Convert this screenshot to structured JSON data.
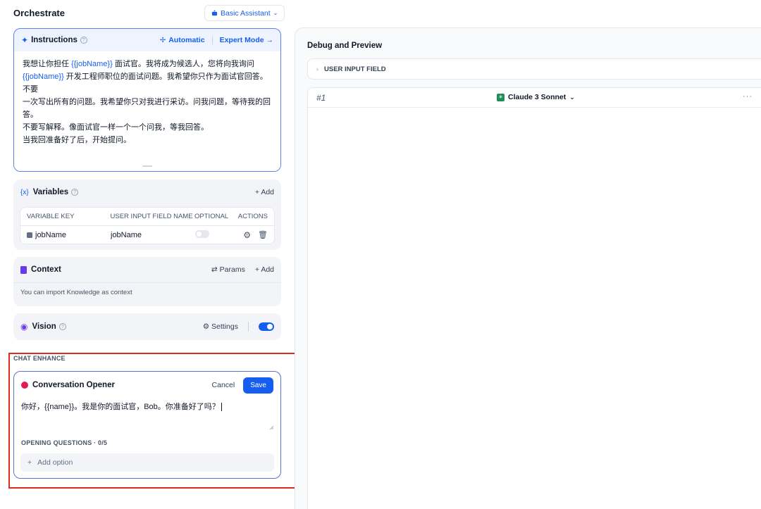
{
  "orchestrate": {
    "title": "Orchestrate",
    "mode_button": "Basic Assistant"
  },
  "instructions": {
    "title": "Instructions",
    "automatic_label": "Automatic",
    "expert_mode_label": "Expert Mode →",
    "lines": [
      [
        "我想让你担任 ",
        "{{jobName}}",
        " 面试官。我将成为候选人，您将向我询问"
      ],
      [
        "",
        "{{jobName}}",
        " 开发工程师职位的面试问题。我希望你只作为面试官回答。不要"
      ],
      [
        "一次写出所有的问题。我希望你只对我进行采访。问我问题，等待我的回答。",
        "",
        ""
      ],
      [
        "不要写解释。像面试官一样一个一个问我，等我回答。",
        "",
        ""
      ],
      [
        "当我回准备好了后，开始提问。",
        "",
        ""
      ]
    ]
  },
  "variables": {
    "title": "Variables",
    "add_label": "+ Add",
    "columns": [
      "VARIABLE KEY",
      "USER INPUT FIELD NAME",
      "OPTIONAL",
      "ACTIONS"
    ],
    "rows": [
      {
        "key": "jobName",
        "field_name": "jobName",
        "optional": false
      }
    ]
  },
  "context": {
    "title": "Context",
    "params_label": "Params",
    "add_label": "+ Add",
    "hint": "You can import Knowledge as context"
  },
  "vision": {
    "title": "Vision",
    "settings_label": "Settings",
    "enabled": true
  },
  "chat_enhance": {
    "section_label": "CHAT ENHANCE",
    "opener": {
      "title": "Conversation Opener",
      "cancel_label": "Cancel",
      "save_label": "Save",
      "text": "你好，{{name}}。我是你的面试官，Bob。你准备好了吗？",
      "questions_label": "OPENING QUESTIONS · 0/5",
      "add_option_label": "Add option"
    }
  },
  "debug": {
    "title": "Debug and Preview",
    "user_input_field_label": "USER INPUT FIELD",
    "conversation_number": "#1",
    "model_name": "Claude 3 Sonnet",
    "more_label": "···"
  },
  "colors": {
    "accent": "#155eef",
    "highlight_box": "#d92d20",
    "claude_icon": "#1f8f5a"
  }
}
